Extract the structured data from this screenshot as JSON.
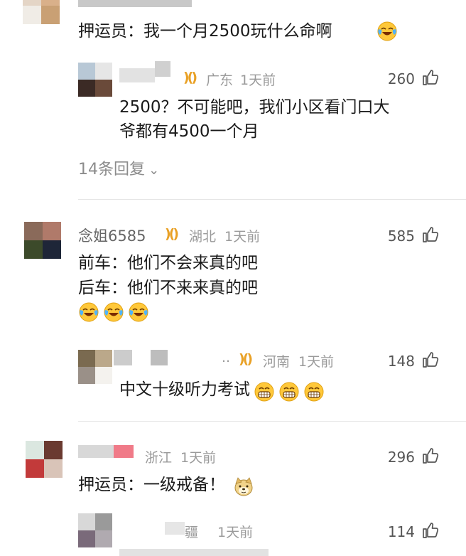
{
  "comments": [
    {
      "text": "押运员：我一个月2500玩什么命啊",
      "reply": {
        "location": "广东",
        "time": "1天前",
        "likes": "260",
        "text_line1": "2500？不可能吧，我们小区看门口大",
        "text_line2": "爷都有4500一个月"
      },
      "replies_label": "14条回复",
      "replies_chevron": "⌄"
    },
    {
      "name": "念姐6585",
      "location": "湖北",
      "time": "1天前",
      "likes": "585",
      "text_line1": "前车：他们不会来真的吧",
      "text_line2": "后车：他们不来来真的吧",
      "reply": {
        "name_tail": "..",
        "location": "河南",
        "time": "1天前",
        "likes": "148",
        "text": "中文十级听力考试"
      }
    },
    {
      "location": "浙江",
      "time": "1天前",
      "likes": "296",
      "text": "押运员：一级戒备！",
      "reply": {
        "location_partial": "疆",
        "time": "1天前",
        "likes": "114"
      }
    }
  ],
  "icons": {
    "thumb": "thumbs-up-icon",
    "vip": "vip-badge-icon",
    "emoji_laugh_cry": "laugh-cry-emoji",
    "emoji_grin": "grin-emoji",
    "emoji_doge": "doge-emoji"
  },
  "colors": {
    "vip": "#e9a126",
    "meta": "#9a9a9a",
    "text": "#1a1a1a"
  }
}
